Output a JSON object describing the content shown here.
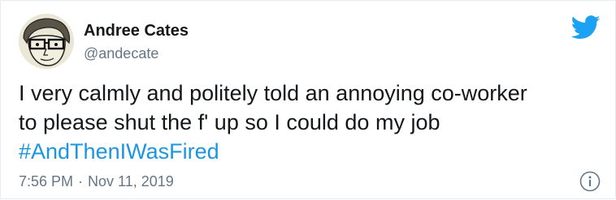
{
  "author": {
    "display_name": "Andree Cates",
    "handle": "@andecate"
  },
  "tweet": {
    "line1": "I very calmly and politely told an annoying co-worker",
    "line2": "to please shut the f' up so I could do my job",
    "hashtag": "#AndThenIWasFired"
  },
  "meta": {
    "time": "7:56 PM",
    "separator": "·",
    "date": "Nov 11, 2019"
  },
  "icons": {
    "logo": "twitter-bird-icon",
    "info": "info-icon"
  },
  "colors": {
    "brand": "#1da1f2",
    "link": "#1b95e0",
    "text": "#14171a",
    "muted": "#657786"
  }
}
